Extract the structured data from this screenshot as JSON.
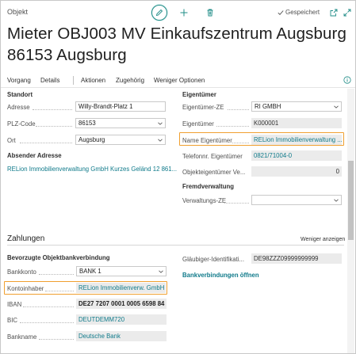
{
  "header": {
    "breadcrumb": "Objekt",
    "saved_label": "Gespeichert",
    "title": "Mieter OBJ003 MV Einkaufszentrum Augsburg 86153 Augsburg"
  },
  "actions": {
    "vorgang": "Vorgang",
    "details": "Details",
    "aktionen": "Aktionen",
    "zugehoerig": "Zugehörig",
    "weniger": "Weniger Optionen"
  },
  "standort": {
    "title": "Standort",
    "adresse_label": "Adresse",
    "adresse_value": "Willy-Brandt-Platz 1",
    "plz_label": "PLZ-Code",
    "plz_value": "86153",
    "ort_label": "Ort",
    "ort_value": "Augsburg",
    "absender_title": "Absender Adresse",
    "absender_value": "RELion Immobilienverwaltung GmbH Kurzes Geländ 12 861..."
  },
  "eigentuemer": {
    "title": "Eigentümer",
    "ze_label": "Eigentümer-ZE",
    "ze_value": "RI GMBH",
    "nr_label": "Eigentümer",
    "nr_value": "K000001",
    "name_label": "Name Eigentümer",
    "name_value": "RELion Immobilienverwaltung ...",
    "tel_label": "Telefonnr. Eigentümer",
    "tel_value": "0821/71004-0",
    "objeig_label": "Objekteigentümer Ve...",
    "objeig_value": "0",
    "fremd_title": "Fremdverwaltung",
    "verw_label": "Verwaltungs-ZE",
    "verw_value": ""
  },
  "zahlungen": {
    "title": "Zahlungen",
    "less_label": "Weniger anzeigen",
    "bank_title": "Bevorzugte Objektbankverbindung",
    "bankkonto_label": "Bankkonto",
    "bankkonto_value": "BANK 1",
    "inhaber_label": "Kontoinhaber",
    "inhaber_value": "RELion Immobilienverw. GmbH",
    "iban_label": "IBAN",
    "iban_value": "DE27 7207 0001 0005 6598 84",
    "bic_label": "BIC",
    "bic_value": "DEUTDEMM720",
    "bankname_label": "Bankname",
    "bankname_value": "Deutsche Bank",
    "glaeubiger_label": "Gläubiger-Identifikati...",
    "glaeubiger_value": "DE98ZZZ09999999999",
    "open_link": "Bankverbindungen öffnen"
  },
  "colors": {
    "accent": "#1f8c87",
    "link": "#0f7a8a",
    "highlight": "#f0a030"
  }
}
